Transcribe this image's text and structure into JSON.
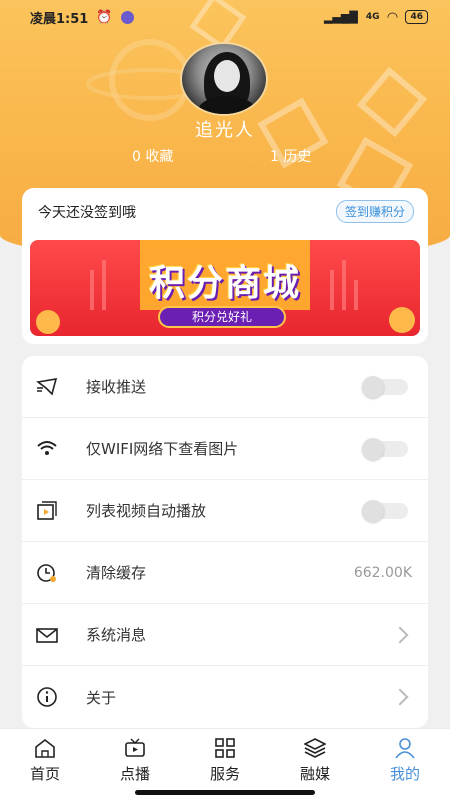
{
  "status_bar": {
    "time": "凌晨1:51",
    "network": "4G",
    "battery": "46"
  },
  "profile": {
    "username": "追光人",
    "favorites": "0 收藏",
    "history": "1 历史"
  },
  "checkin": {
    "title": "今天还没签到哦",
    "button_label": "签到赚积分",
    "banner_title": "积分商城",
    "banner_subtitle": "积分兑好礼"
  },
  "settings": [
    {
      "label": "接收推送",
      "icon": "send-icon",
      "control": "toggle",
      "on": false
    },
    {
      "label": "仅WIFI网络下查看图片",
      "icon": "wifi-icon",
      "control": "toggle",
      "on": false
    },
    {
      "label": "列表视频自动播放",
      "icon": "video-play-icon",
      "control": "toggle",
      "on": false
    },
    {
      "label": "清除缓存",
      "icon": "clock-icon",
      "control": "value",
      "value": "662.00K"
    },
    {
      "label": "系统消息",
      "icon": "mail-icon",
      "control": "chevron"
    },
    {
      "label": "关于",
      "icon": "info-icon",
      "control": "chevron"
    }
  ],
  "tabbar": [
    {
      "label": "首页",
      "icon": "home-icon",
      "active": false
    },
    {
      "label": "点播",
      "icon": "tv-icon",
      "active": false
    },
    {
      "label": "服务",
      "icon": "grid-icon",
      "active": false
    },
    {
      "label": "融媒",
      "icon": "layers-icon",
      "active": false
    },
    {
      "label": "我的",
      "icon": "user-icon",
      "active": true
    }
  ],
  "colors": {
    "accent": "#4a90d9",
    "header": "#f9b54a",
    "banner": "#e8262f"
  }
}
